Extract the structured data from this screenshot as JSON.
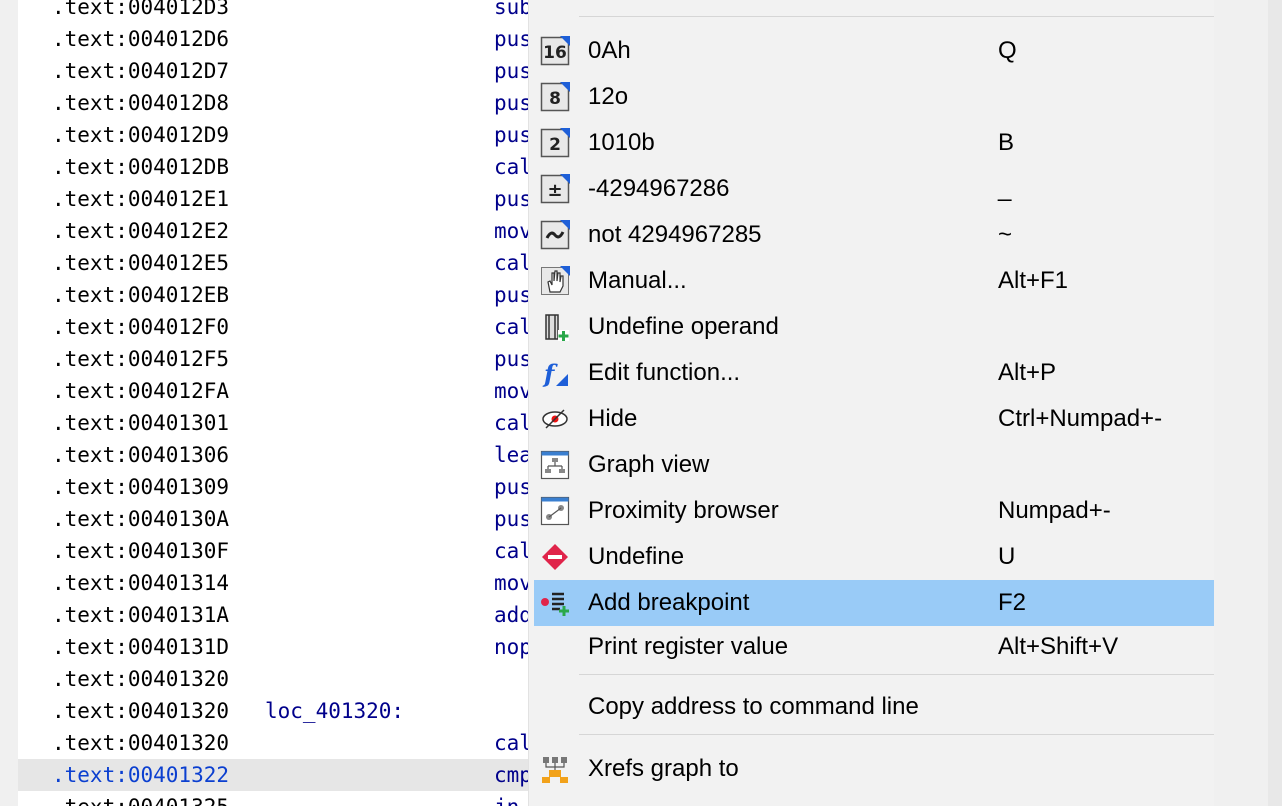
{
  "disasm": {
    "lines": [
      {
        "addr": ".text:004012D3",
        "label": "",
        "mnemonic": "sub"
      },
      {
        "addr": ".text:004012D6",
        "label": "",
        "mnemonic": "pus"
      },
      {
        "addr": ".text:004012D7",
        "label": "",
        "mnemonic": "pus"
      },
      {
        "addr": ".text:004012D8",
        "label": "",
        "mnemonic": "pus"
      },
      {
        "addr": ".text:004012D9",
        "label": "",
        "mnemonic": "pus"
      },
      {
        "addr": ".text:004012DB",
        "label": "",
        "mnemonic": "cal"
      },
      {
        "addr": ".text:004012E1",
        "label": "",
        "mnemonic": "pus"
      },
      {
        "addr": ".text:004012E2",
        "label": "",
        "mnemonic": "mov"
      },
      {
        "addr": ".text:004012E5",
        "label": "",
        "mnemonic": "cal"
      },
      {
        "addr": ".text:004012EB",
        "label": "",
        "mnemonic": "pus"
      },
      {
        "addr": ".text:004012F0",
        "label": "",
        "mnemonic": "cal"
      },
      {
        "addr": ".text:004012F5",
        "label": "",
        "mnemonic": "pus"
      },
      {
        "addr": ".text:004012FA",
        "label": "",
        "mnemonic": "mov"
      },
      {
        "addr": ".text:00401301",
        "label": "",
        "mnemonic": "cal"
      },
      {
        "addr": ".text:00401306",
        "label": "",
        "mnemonic": "lea"
      },
      {
        "addr": ".text:00401309",
        "label": "",
        "mnemonic": "pus"
      },
      {
        "addr": ".text:0040130A",
        "label": "",
        "mnemonic": "pus"
      },
      {
        "addr": ".text:0040130F",
        "label": "",
        "mnemonic": "cal"
      },
      {
        "addr": ".text:00401314",
        "label": "",
        "mnemonic": "mov"
      },
      {
        "addr": ".text:0040131A",
        "label": "",
        "mnemonic": "add"
      },
      {
        "addr": ".text:0040131D",
        "label": "",
        "mnemonic": "nop"
      },
      {
        "addr": ".text:00401320",
        "label": "",
        "mnemonic": ""
      },
      {
        "addr": ".text:00401320",
        "label": "loc_401320:",
        "mnemonic": ""
      },
      {
        "addr": ".text:00401320",
        "label": "",
        "mnemonic": "cal"
      },
      {
        "addr": ".text:00401322",
        "label": "",
        "mnemonic": "cmp",
        "current": true
      },
      {
        "addr": ".text:00401325",
        "label": "",
        "mnemonic": "jn"
      }
    ]
  },
  "context_menu": {
    "items": [
      {
        "icon": "number-base-16-icon",
        "label": "0Ah",
        "shortcut": "Q"
      },
      {
        "icon": "number-base-8-icon",
        "label": "12o",
        "shortcut": ""
      },
      {
        "icon": "number-base-2-icon",
        "label": "1010b",
        "shortcut": "B"
      },
      {
        "icon": "plus-minus-icon",
        "label": "-4294967286",
        "shortcut": "_"
      },
      {
        "icon": "tilde-icon",
        "label": "not 4294967285",
        "shortcut": "~"
      },
      {
        "icon": "hand-icon",
        "label": "Manual...",
        "shortcut": "Alt+F1"
      },
      {
        "icon": "undefine-operand-icon",
        "label": "Undefine operand",
        "shortcut": ""
      },
      {
        "icon": "function-icon",
        "label": "Edit function...",
        "shortcut": "Alt+P"
      },
      {
        "icon": "eye-hide-icon",
        "label": "Hide",
        "shortcut": "Ctrl+Numpad+-"
      },
      {
        "icon": "graph-view-icon",
        "label": "Graph view",
        "shortcut": ""
      },
      {
        "icon": "proximity-browser-icon",
        "label": "Proximity browser",
        "shortcut": "Numpad+-"
      },
      {
        "icon": "undefine-icon",
        "label": "Undefine",
        "shortcut": "U"
      },
      {
        "icon": "add-breakpoint-icon",
        "label": "Add breakpoint",
        "shortcut": "F2",
        "highlighted": true
      },
      {
        "icon": "",
        "label": "Print register value",
        "shortcut": "Alt+Shift+V"
      },
      {
        "icon": "",
        "label": "Copy address to command line",
        "shortcut": ""
      },
      {
        "icon": "xrefs-graph-icon",
        "label": "Xrefs graph to",
        "shortcut": ""
      }
    ]
  },
  "colors": {
    "menu_highlight": "#99cbf7",
    "current_line": "#e6e6e6",
    "code_blue": "#00008b",
    "address_blue": "#0b3fd0"
  }
}
